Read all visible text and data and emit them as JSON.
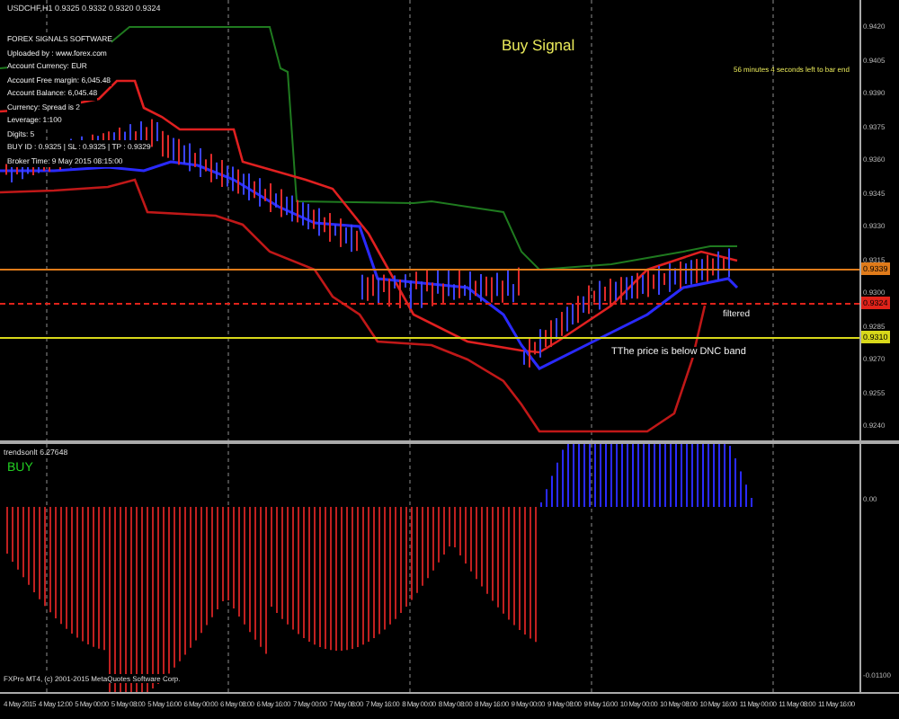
{
  "chart": {
    "title": "USDCHF,H1 0.9325 0.9332 0.9320 0.9324",
    "info_panel": [
      "FOREX SIGNALS SOFTWARE",
      "Uploaded by : www.forex.com",
      "Account Currency: EUR",
      "Account Free margin: 6,045.48",
      "Account Balance: 6,045.48",
      "Currency: Spread is 2",
      "Leverage: 1:100",
      "Digits: 5",
      "BUY ID : 0.9325 | SL : 0.9325 | TP : 0.9329",
      "Broker Time: 9 May 2015 08:15:00"
    ],
    "signal": "Buy Signal",
    "timer": "56 minutes 4 seconds left to bar end",
    "band_note": "TThe price is below DNC band",
    "filter_note": "filtered",
    "price_axis": [
      "0.9420",
      "0.9405",
      "0.9390",
      "0.9375",
      "0.9360",
      "0.9345",
      "0.9330",
      "0.9315",
      "0.9300",
      "0.9285",
      "0.9270",
      "0.9255",
      "0.9240"
    ],
    "price_lines": [
      {
        "label": "0.9339",
        "color": "#e07b1a"
      },
      {
        "label": "0.9324",
        "color": "#e0231a"
      },
      {
        "label": "0.9310",
        "color": "#d8d81a"
      }
    ]
  },
  "indicator": {
    "title": "trendsonlt 6.27648",
    "signal": "BUY",
    "copyright": "FXPro MT4, (c) 2001-2015 MetaQuotes Software Corp.",
    "axis": [
      "0.00",
      "-0.01100"
    ]
  },
  "time_axis": [
    "4 May 2015",
    "4 May 12:00",
    "5 May 00:00",
    "5 May 08:00",
    "5 May 16:00",
    "6 May 00:00",
    "6 May 08:00",
    "6 May 16:00",
    "7 May 00:00",
    "7 May 08:00",
    "7 May 16:00",
    "8 May 00:00",
    "8 May 08:00",
    "8 May 16:00",
    "9 May 00:00",
    "9 May 08:00",
    "9 May 16:00",
    "10 May 00:00",
    "10 May 08:00",
    "10 May 16:00",
    "11 May 00:00",
    "11 May 08:00",
    "11 May 16:00"
  ]
}
